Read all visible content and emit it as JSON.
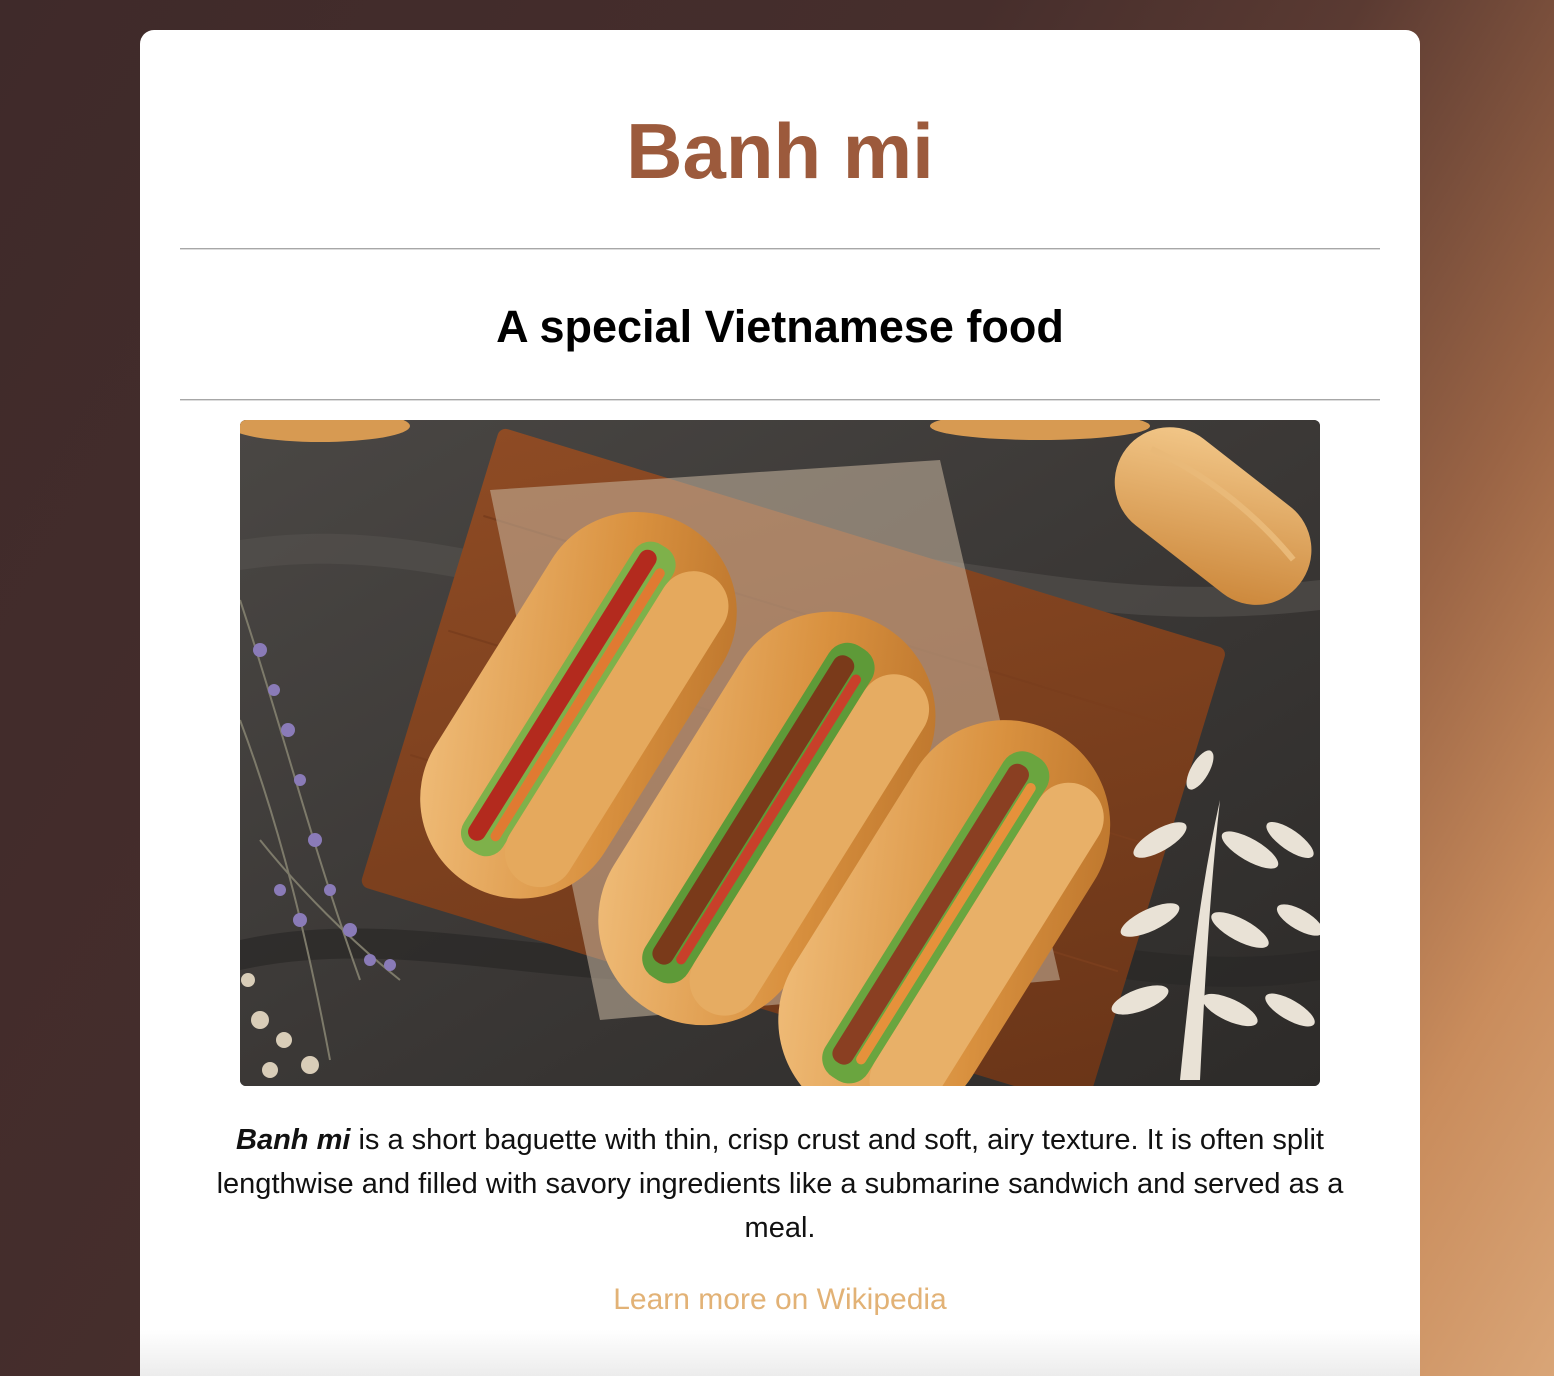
{
  "page": {
    "title": "Banh mi",
    "subtitle": "A special Vietnamese food",
    "description_term": "Banh mi",
    "description_text": " is a short baguette with thin, crisp crust and soft, airy texture. It is often split lengthwise and filled with savory ingredients like a submarine sandwich and served as a meal.",
    "link_label": "Learn more on Wikipedia"
  },
  "colors": {
    "title": "#9c5a3c",
    "link": "#e2b276",
    "card": "#ffffff"
  }
}
